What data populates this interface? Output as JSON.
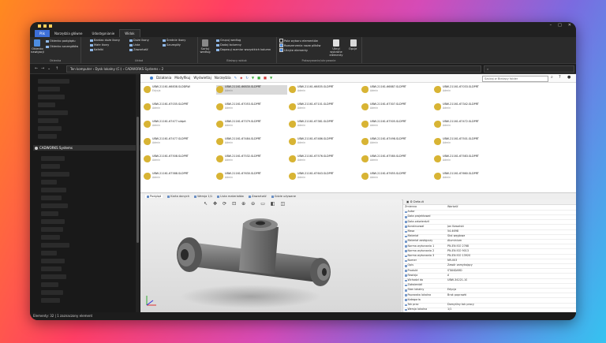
{
  "tabs": {
    "file": "Plik",
    "home": "Narzędzia główne",
    "share": "Udostępnianie",
    "view": "Widok"
  },
  "ribbon": {
    "panels": {
      "label": "Okienka",
      "nav": "Okienko nawigacji",
      "preview": "Okienko podglądu",
      "details": "Okienko szczegółów"
    },
    "layout": {
      "label": "Układ",
      "xl": "Bardzo duże ikony",
      "large": "Duże ikony",
      "medium": "Średnie ikony",
      "small": "Małe ikony",
      "list": "Lista",
      "details": "Szczegóły",
      "tiles": "Kafelki",
      "content": "Zawartość"
    },
    "view": {
      "label": "Bieżący widok",
      "sort": "Sortuj według",
      "group": "Grupuj według",
      "add_cols": "Dodaj kolumny",
      "fit": "Dopasuj rozmiar wszystkich kolumn"
    },
    "show": {
      "label": "Pokazywanie/ukrywanie",
      "checkboxes": "Pola wyboru elementów",
      "extensions": "Rozszerzenia nazw plików",
      "hidden": "Ukryte elementy",
      "hide_sel": "Ukryj wybrane elementy",
      "options": "Opcje"
    }
  },
  "address": {
    "path": "Ten komputer  ›  Dysk lokalny (C:)  ›  CADWORKS Systems  ›  2"
  },
  "sidebar": {
    "cad": "CADWORKS Systems"
  },
  "cad_menu": [
    "Działania",
    "Modyfikuj",
    "Wyświetlaj",
    "Narzędzia"
  ],
  "cad_search": "Szukaj w Bieżący folder",
  "files": [
    [
      {
        "n": "UBW-21161-66838.SLDDRW",
        "a": "Edycja"
      },
      {
        "n": "UBW-21161-66830.SLDPRT",
        "a": "Admin",
        "sel": true
      },
      {
        "n": "UBW-21161-66835.SLDPRT",
        "a": "Admin"
      },
      {
        "n": "UBW-21161-66887.SLDPRT",
        "a": "Admin"
      },
      {
        "n": "UBW-21161-67033.SLDPRT",
        "a": "Admin"
      }
    ],
    [
      {
        "n": "UBW-21161-67035.SLDPRT",
        "a": "Admin"
      },
      {
        "n": "UBW-21161-67053.SLDPRT",
        "a": "Admin"
      },
      {
        "n": "UBW-21161-67101.SLDPRT",
        "a": "Admin"
      },
      {
        "n": "UBW-21161-67307.SLDPRT",
        "a": "Admin"
      },
      {
        "n": "UBW-21161-67342.SLDPRT",
        "a": "Admin"
      }
    ],
    [
      {
        "n": "UBW-21161-67477.sldprt",
        "a": "Admin"
      },
      {
        "n": "UBW-21161-67379.SLDPRT",
        "a": "Admin"
      },
      {
        "n": "UBW-21161-67381.SLDPRT",
        "a": "Admin"
      },
      {
        "n": "UBW-21161-67505.SLDPRT",
        "a": "Admin"
      },
      {
        "n": "UBW-21161-67472.SLDPRT",
        "a": "Admin"
      }
    ],
    [
      {
        "n": "UBW-21161-67477.SLDPRT",
        "a": "Admin"
      },
      {
        "n": "UBW-21161-67484.SLDPRT",
        "a": "Admin"
      },
      {
        "n": "UBW-21161-67486.SLDPRT",
        "a": "Admin"
      },
      {
        "n": "UBW-21161-67498.SLDPRT",
        "a": "Admin"
      },
      {
        "n": "UBW-21161-67501.SLDPRT",
        "a": "Admin"
      }
    ],
    [
      {
        "n": "UBW-21161-67508.SLDPRT",
        "a": "Admin"
      },
      {
        "n": "UBW-21161-67532.SLDPRT",
        "a": "Admin"
      },
      {
        "n": "UBW-21161-67576.SLDPRT",
        "a": "Admin"
      },
      {
        "n": "UBW-21161-67580.SLDPRT",
        "a": "Admin"
      },
      {
        "n": "UBW-21161-67583.SLDPRT",
        "a": "Admin"
      }
    ],
    [
      {
        "n": "UBW-21161-67588.SLDPRT",
        "a": "Admin"
      },
      {
        "n": "UBW-21161-67630.SLDPRT",
        "a": "Admin"
      },
      {
        "n": "UBW-21161-67643.SLDPRT",
        "a": "Admin"
      },
      {
        "n": "UBW-21161-67655.SLDPRT",
        "a": "Admin"
      },
      {
        "n": "UBW-21161-67660.SLDPRT",
        "a": "Admin"
      }
    ]
  ],
  "preview_tabs": [
    "Podgląd",
    "Karta danych",
    "Wersja 1/1",
    "Lista materiałów",
    "Zawartość",
    "Gdzie używane"
  ],
  "props_header": "Default",
  "props": [
    {
      "k": "Zmienna",
      "v": "Wartość"
    },
    {
      "k": "Autor",
      "v": ""
    },
    {
      "k": "Data projektował",
      "v": ""
    },
    {
      "k": "Data zatwierdził",
      "v": ""
    },
    {
      "k": "Konstruował",
      "v": "Jan Kowalski"
    },
    {
      "k": "Masa",
      "v": "54.4698"
    },
    {
      "k": "Materiał",
      "v": "Stal węglowa"
    },
    {
      "k": "Materiał zastępczy",
      "v": "Aluminium"
    },
    {
      "k": "Norma wykonania 1",
      "v": "PN-EN ISO 2768"
    },
    {
      "k": "Norma wykonania 2",
      "v": "PN-EN ISO 9013"
    },
    {
      "k": "Norma wykonania 3",
      "v": "PN-EN ISO 13920"
    },
    {
      "k": "Numer",
      "v": "NR-003"
    },
    {
      "k": "Opis",
      "v": "Zawór zamykający"
    },
    {
      "k": "Produkt",
      "v": "STANDARD"
    },
    {
      "k": "Rewizja",
      "v": "A"
    },
    {
      "k": "Wchodzi do",
      "v": "UBW-34221-10"
    },
    {
      "k": "Zatwierdził",
      "v": ""
    },
    {
      "k": "Stan lokalny",
      "v": "Edycja"
    },
    {
      "k": "Poprawka lokalna",
      "v": "Brak poprawki"
    },
    {
      "k": "Kategoria",
      "v": ""
    },
    {
      "k": "Tok prac",
      "v": "Domyślny tok pracy"
    },
    {
      "k": "Wersja lokalna",
      "v": "1/1"
    }
  ],
  "status": "Elementy: 32  |  1 zaznaczony element"
}
